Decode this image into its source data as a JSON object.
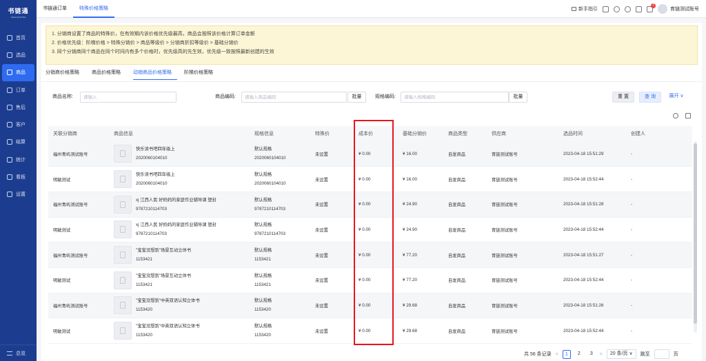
{
  "sidebar": {
    "logo_name": "书链通",
    "logo_sub": "SHULIANTONG",
    "items": [
      {
        "label": "首页"
      },
      {
        "label": "选品"
      },
      {
        "label": "商品",
        "active": true
      },
      {
        "label": "订单"
      },
      {
        "label": "售后"
      },
      {
        "label": "客户"
      },
      {
        "label": "结算"
      },
      {
        "label": "统计"
      },
      {
        "label": "看板"
      },
      {
        "label": "设置"
      }
    ],
    "bottom_label": "总览"
  },
  "topbar": {
    "tabs": [
      {
        "label": "书链通订单"
      },
      {
        "label": "特殊价格策略"
      }
    ],
    "guide_label": "新手指引",
    "notification_count": "7",
    "user_name": "育链测试账号"
  },
  "notice": [
    "1. 分销商设置了商品的特殊价，在有效期内该价格优先级最高，商品会按照该价格计算订单金额",
    "2. 价格优先级：阶梯价格 > 特殊分销价 > 商品等级价 > 分销商折扣等级价 > 基础分销价",
    "3. 同个分销商同个商品在同个时间内有多个价格时，优先级高的先生效，优先级一致按照最新创建的生效"
  ],
  "sub_tabs": [
    {
      "label": "分销商价格策略"
    },
    {
      "label": "商品价格策略"
    },
    {
      "label": "动销商品价格策略"
    },
    {
      "label": "阶梯价格策略"
    }
  ],
  "filter": {
    "name_label": "商品名称:",
    "name_placeholder": "请输入",
    "code_label": "商品编码:",
    "code_placeholder": "请输入商品编码",
    "batch1": "批量",
    "spec_label": "规格编码:",
    "spec_placeholder": "请输入规格编码",
    "batch2": "批量",
    "reset": "重 置",
    "query": "查 询",
    "expand": "展开 ∨"
  },
  "table": {
    "headers": [
      "关联分销商",
      "商品信息",
      "规格信息",
      "特殊价",
      "成本价",
      "基础分销价",
      "商品类型",
      "供应商",
      "选品时间",
      "创建人"
    ],
    "rows": [
      {
        "distributor": "福州青屿测试账号",
        "product_name": "快乐读书吧四年级上",
        "product_code": "2020060104010",
        "spec_name": "默认规格",
        "spec_code": "2020060104010",
        "special_price": "未设置",
        "cost_price": "¥ 0.00",
        "base_price": "¥ 16.00",
        "type": "自发商品",
        "supplier": "育链测试账号",
        "time": "2023-04-18 15:51:29",
        "creator": "-"
      },
      {
        "distributor": "明敏测试",
        "product_name": "快乐读书吧四年级上",
        "product_code": "2020060104010",
        "spec_name": "默认规格",
        "spec_code": "2020060104010",
        "special_price": "未设置",
        "cost_price": "¥ 0.00",
        "base_price": "¥ 16.00",
        "type": "自发商品",
        "supplier": "育链测试账号",
        "time": "2023-04-18 15:52:44",
        "creator": "-"
      },
      {
        "distributor": "福州青屿测试账号",
        "product_name": "xj 江西人民 好妈妈的家庭作业辅导课 塑封",
        "product_code": "9787210114703",
        "spec_name": "默认规格",
        "spec_code": "9787210114703",
        "special_price": "未设置",
        "cost_price": "¥ 0.00",
        "base_price": "¥ 24.90",
        "type": "自发商品",
        "supplier": "育链测试账号",
        "time": "2023-04-18 15:51:28",
        "creator": "-"
      },
      {
        "distributor": "明敏测试",
        "product_name": "xj 江西人民 好妈妈的家庭作业辅导课 塑封",
        "product_code": "9787210114703",
        "spec_name": "默认规格",
        "spec_code": "9787210114703",
        "special_price": "未设置",
        "cost_price": "¥ 0.00",
        "base_price": "¥ 24.90",
        "type": "自发商品",
        "supplier": "育链测试账号",
        "time": "2023-04-18 15:52:44",
        "creator": "-"
      },
      {
        "distributor": "福州青屿测试账号",
        "product_name": "\"宝宝没想到\"场景互动立体书",
        "product_code": "1153421",
        "spec_name": "默认规格",
        "spec_code": "1153421",
        "special_price": "未设置",
        "cost_price": "¥ 0.00",
        "base_price": "¥ 77.20",
        "type": "自发商品",
        "supplier": "育链测试账号",
        "time": "2023-04-18 15:51:27",
        "creator": "-"
      },
      {
        "distributor": "明敏测试",
        "product_name": "\"宝宝没想到\"场景互动立体书",
        "product_code": "1153421",
        "spec_name": "默认规格",
        "spec_code": "1153421",
        "special_price": "未设置",
        "cost_price": "¥ 0.00",
        "base_price": "¥ 77.20",
        "type": "自发商品",
        "supplier": "育链测试账号",
        "time": "2023-04-18 15:52:44",
        "creator": "-"
      },
      {
        "distributor": "福州青屿测试账号",
        "product_name": "\"宝宝没想到\"中英双语认知立体书",
        "product_code": "1153420",
        "spec_name": "默认规格",
        "spec_code": "1153420",
        "special_price": "未设置",
        "cost_price": "¥ 0.00",
        "base_price": "¥ 29.68",
        "type": "自发商品",
        "supplier": "育链测试账号",
        "time": "2023-04-18 15:51:26",
        "creator": "-"
      },
      {
        "distributor": "明敏测试",
        "product_name": "\"宝宝没想到\"中英双语认知立体书",
        "product_code": "1153420",
        "spec_name": "默认规格",
        "spec_code": "1153420",
        "special_price": "未设置",
        "cost_price": "¥ 0.00",
        "base_price": "¥ 29.68",
        "type": "自发商品",
        "supplier": "育链测试账号",
        "time": "2023-04-18 15:52:44",
        "creator": "-"
      }
    ]
  },
  "pagination": {
    "total": "共 56 条记录",
    "pages": [
      "1",
      "2",
      "3"
    ],
    "page_size": "20 条/页 ∨",
    "goto_label": "跳至",
    "page_suffix": "页"
  },
  "colors": {
    "sidebar_bg": "#1c3d8f",
    "accent": "#2f6bf0",
    "highlight_box": "#e8141c"
  }
}
